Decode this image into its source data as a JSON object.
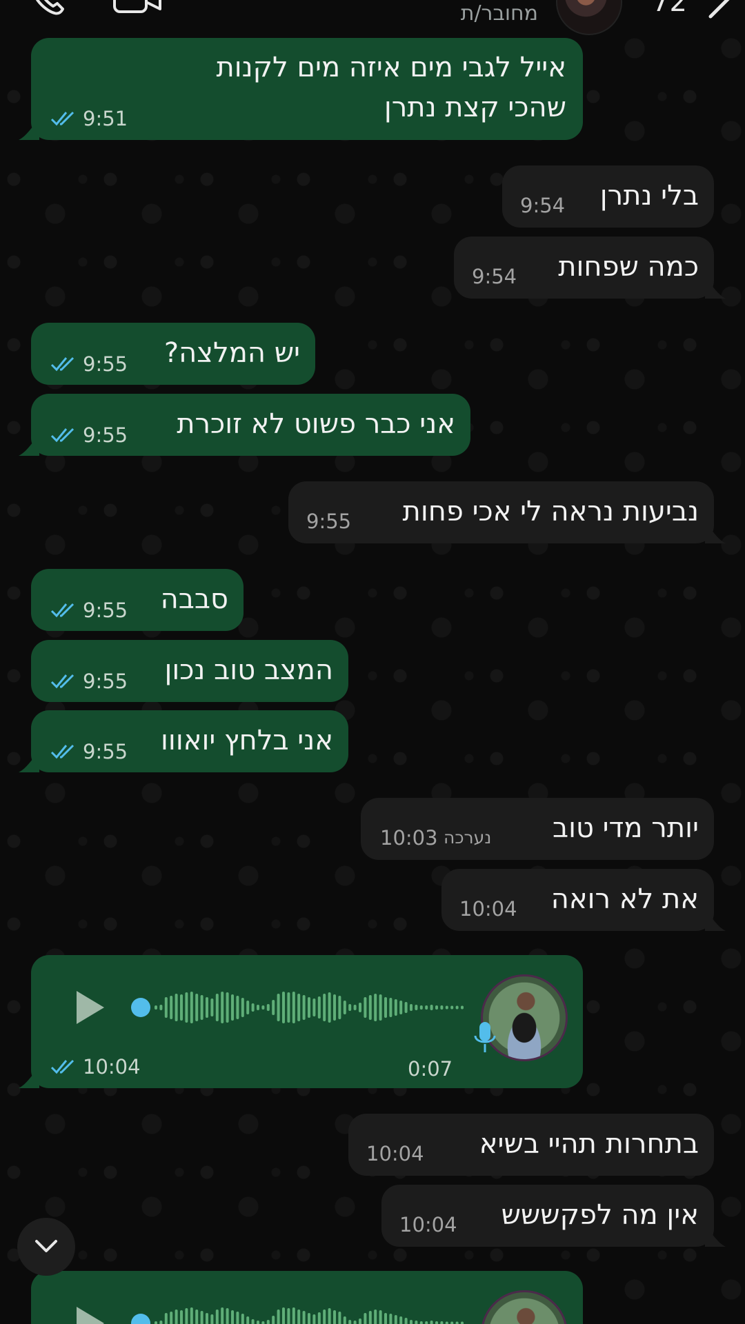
{
  "header": {
    "status": "מחובר/ת",
    "unread_count": "72",
    "icons": [
      "phone-icon",
      "video-icon",
      "back-chevron-icon"
    ]
  },
  "messages": [
    {
      "direction": "outgoing",
      "text": "אייל לגבי מים איזה מים לקנות שהכי קצת נתרן",
      "time": "9:51",
      "read": true
    },
    {
      "direction": "incoming",
      "text": "בלי נתרן",
      "time": "9:54"
    },
    {
      "direction": "incoming",
      "text": "כמה שפחות",
      "time": "9:54"
    },
    {
      "direction": "outgoing",
      "text": "יש המלצה?",
      "time": "9:55",
      "read": true
    },
    {
      "direction": "outgoing",
      "text": "אני כבר פשוט לא זוכרת",
      "time": "9:55",
      "read": true
    },
    {
      "direction": "incoming",
      "text": "נביעות נראה לי אכי פחות",
      "time": "9:55"
    },
    {
      "direction": "outgoing",
      "text": "סבבה",
      "time": "9:55",
      "read": true
    },
    {
      "direction": "outgoing",
      "text": "המצב טוב נכון",
      "time": "9:55",
      "read": true
    },
    {
      "direction": "outgoing",
      "text": "אני בלחץ יואווו",
      "time": "9:55",
      "read": true
    },
    {
      "direction": "incoming",
      "text": "יותר  מדי טוב",
      "time": "10:03",
      "edited_label": "נערכה"
    },
    {
      "direction": "incoming",
      "text": "את לא רואה",
      "time": "10:04"
    },
    {
      "direction": "outgoing",
      "type": "voice",
      "duration": "0:07",
      "time": "10:04",
      "read": true
    },
    {
      "direction": "incoming",
      "text": "בתחרות תהיי בשיא",
      "time": "10:04"
    },
    {
      "direction": "incoming",
      "text": "אין מה לפקששש",
      "time": "10:04"
    }
  ],
  "colors": {
    "background": "#0b0b0b",
    "outgoing_bubble": "#144d2e",
    "incoming_bubble": "#1c1c1c",
    "read_ticks": "#53bdeb",
    "waveform": "#5fae78"
  }
}
